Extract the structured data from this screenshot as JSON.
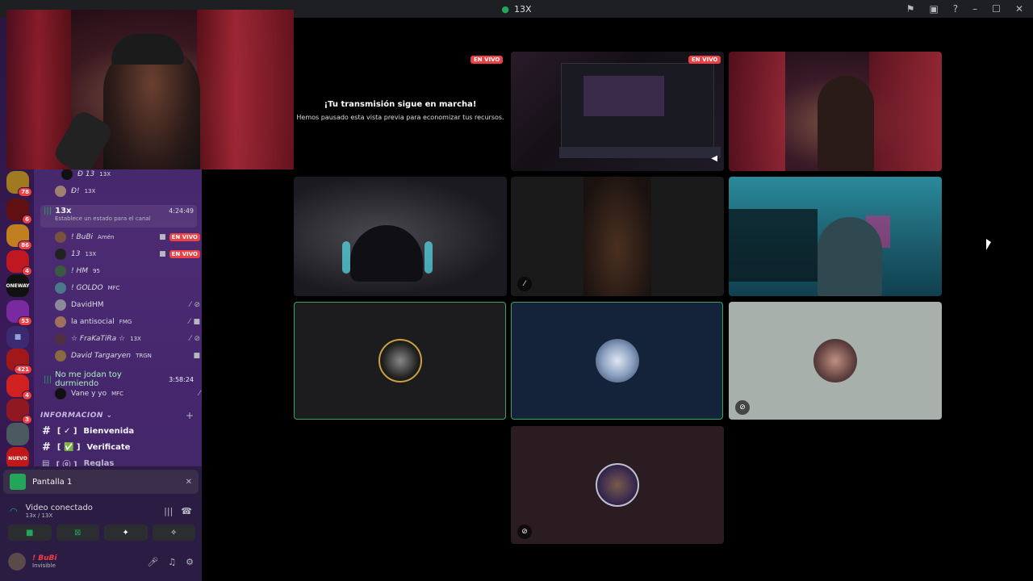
{
  "window": {
    "title": "13X"
  },
  "servers": [
    {
      "badge": "78"
    },
    {
      "badge": "6"
    },
    {
      "badge": "86"
    },
    {
      "badge": "4"
    },
    {
      "label": "ONEWAY",
      "badge": ""
    },
    {
      "badge": "53"
    },
    {
      "badge": ""
    },
    {
      "badge": "421"
    },
    {
      "badge": "4"
    },
    {
      "badge": "3"
    },
    {
      "badge": ""
    },
    {
      "label": "NUEVO",
      "badge": ""
    }
  ],
  "voice_users_top": [
    {
      "name": "Ð 13",
      "tag": "13X"
    },
    {
      "name": "Ð!",
      "tag": "13X"
    }
  ],
  "channel_13x": {
    "name": "13x",
    "status": "Establece un estado para el canal",
    "time": "4:24:49",
    "users": [
      {
        "name": "! BuBi",
        "tag": "Amén",
        "live": "EN VIVO"
      },
      {
        "name": "13",
        "tag": "13X",
        "live": "EN VIVO"
      },
      {
        "name": "! HM",
        "tag": "95",
        "live": ""
      },
      {
        "name": "! GOLDO",
        "tag": "MFC",
        "live": ""
      },
      {
        "name": "DavidHM",
        "tag": "",
        "live": ""
      },
      {
        "name": "la antisocial",
        "tag": "FMG",
        "live": ""
      },
      {
        "name": "☆ FraKaTiRa ☆",
        "tag": "13X",
        "live": ""
      },
      {
        "name": "David Targaryen",
        "tag": "TRGN",
        "live": ""
      }
    ]
  },
  "channel_2": {
    "name": "No me jodan toy durmiendo",
    "time": "3:58:24",
    "users": [
      {
        "name": "Vane y yo",
        "tag": "MFC"
      }
    ]
  },
  "category": {
    "name": "INFORMACION"
  },
  "text_channels": [
    {
      "name": "Bienvenida",
      "prefix": "[ ✓ ]"
    },
    {
      "name": "Verificate",
      "prefix": "[ ✅ ]"
    },
    {
      "name": "Reglas",
      "prefix": "[ ⓞ ]"
    }
  ],
  "screen_share": {
    "label": "Pantalla 1"
  },
  "voice_status": {
    "title": "Video conectado",
    "subtitle": "13x / 13X"
  },
  "user_panel": {
    "name": "! BuBi",
    "status": "Invisible"
  },
  "stage": {
    "paused_title": "¡Tu transmisión sigue en marcha!",
    "paused_sub": "Hemos pausado esta vista previa para economizar tus recursos.",
    "live_label": "EN VIVO"
  },
  "colors": {
    "accent_green": "#23a55a",
    "live_red": "#ed4245",
    "sidebar": "#3a2360"
  }
}
